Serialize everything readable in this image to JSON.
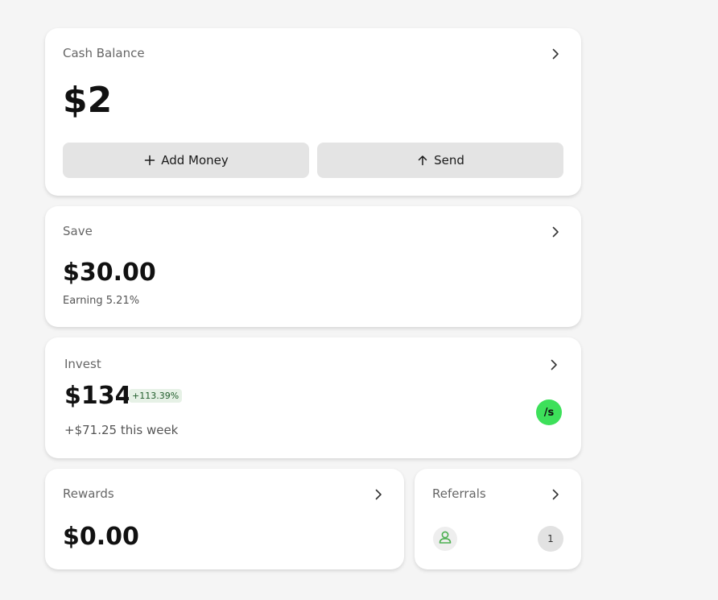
{
  "cash": {
    "label": "Cash Balance",
    "amount": "$2",
    "add_money_label": "Add Money",
    "send_label": "Send"
  },
  "save": {
    "label": "Save",
    "amount": "$30.00",
    "earning": "Earning 5.21%"
  },
  "invest": {
    "label": "Invest",
    "amount": "$134",
    "change_badge": "+113.39%",
    "weekly": "+$71.25 this week",
    "logo_text": "/s"
  },
  "rewards": {
    "label": "Rewards",
    "amount": "$0.00"
  },
  "referrals": {
    "label": "Referrals",
    "count": "1"
  },
  "colors": {
    "background": "#f5f5f5",
    "card": "#ffffff",
    "button": "#e4e4e4",
    "accent_green": "#3de05a",
    "badge_green_bg": "#e6f1e6",
    "badge_green_text": "#1f5c2a",
    "avatar_icon": "#4caf50"
  },
  "icons": {
    "chevron": "chevron-right-icon",
    "add": "plus-icon",
    "send": "arrow-up-icon",
    "person": "person-icon"
  }
}
